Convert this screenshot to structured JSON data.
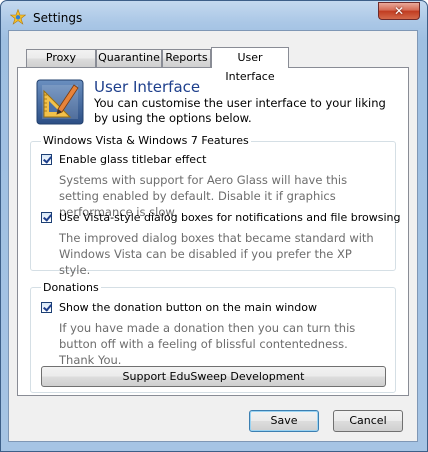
{
  "window": {
    "title": "Settings",
    "close_label": "✕"
  },
  "tabs": [
    {
      "label": "Proxy Server"
    },
    {
      "label": "Quarantine"
    },
    {
      "label": "Reports"
    },
    {
      "label": "User Interface"
    }
  ],
  "header": {
    "title": "User Interface",
    "description": "You can customise the user interface to your liking by using the options below.",
    "icon": "ruler-pencil-icon"
  },
  "vista_group": {
    "label": "Windows Vista & Windows 7 Features",
    "options": [
      {
        "label": "Enable glass titlebar effect",
        "checked": true,
        "description": "Systems with support for Aero Glass will have this setting enabled by default. Disable it if graphics performance is slow."
      },
      {
        "label": "Use Vista-style dialog boxes for notifications and file browsing",
        "checked": true,
        "description": "The improved dialog boxes that became standard with Windows Vista can be disabled if you prefer the XP style."
      }
    ]
  },
  "donations_group": {
    "label": "Donations",
    "option": {
      "label": "Show the donation button on the main window",
      "checked": true,
      "description": "If you have made a donation then you can turn this button off with a feeling of blissful contentedness. Thank You."
    },
    "button_label": "Support EduSweep Development"
  },
  "footer": {
    "save_label": "Save",
    "cancel_label": "Cancel"
  }
}
